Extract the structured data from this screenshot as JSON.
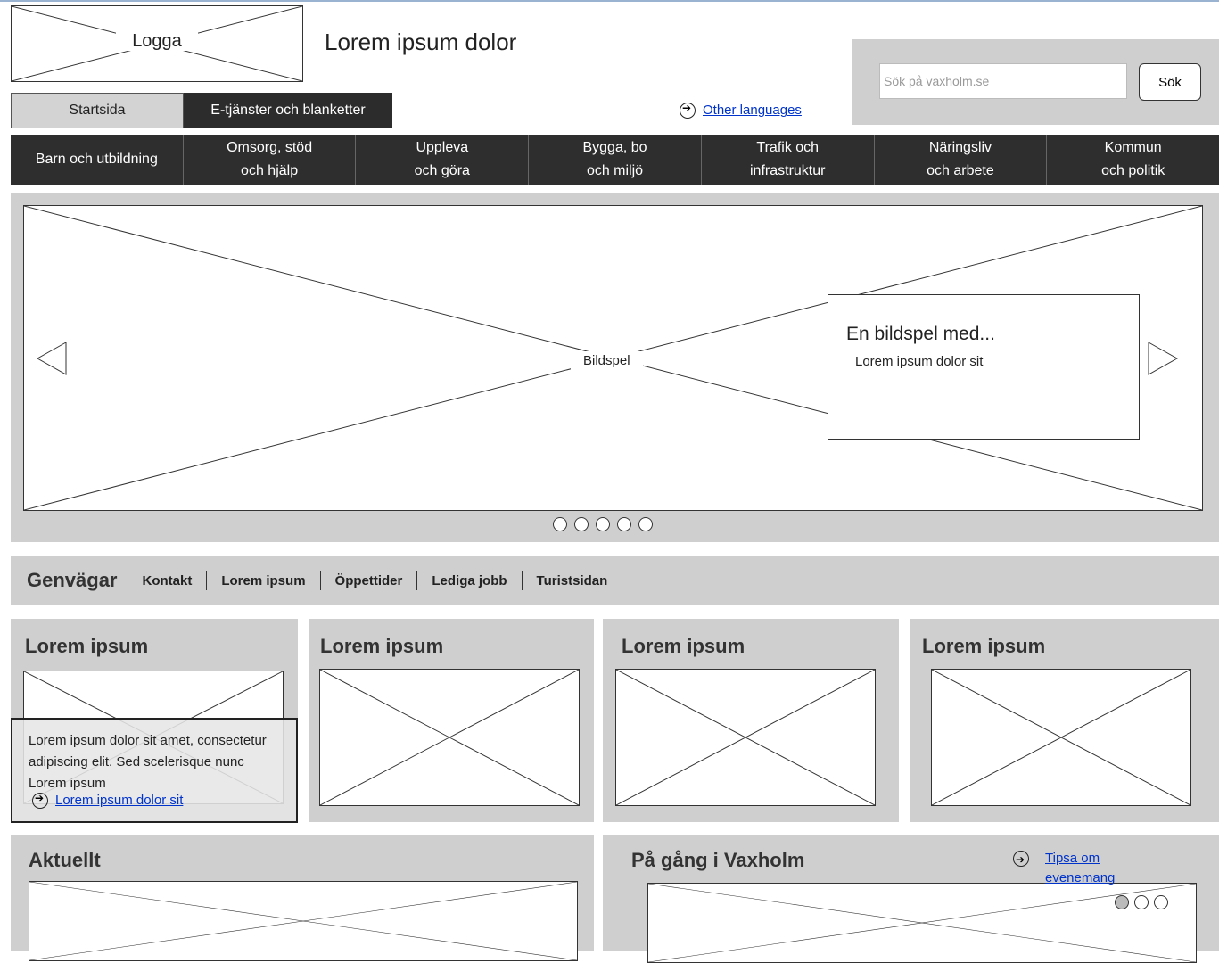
{
  "header": {
    "logo_label": "Logga",
    "site_title": "Lorem ipsum dolor",
    "search": {
      "placeholder": "Sök på vaxholm.se",
      "button_label": "Sök"
    },
    "tabs": [
      {
        "label": "Startsida"
      },
      {
        "label": "E-tjänster och blanketter"
      }
    ],
    "other_languages": "Other languages"
  },
  "nav": {
    "items": [
      {
        "line1": "Barn och utbildning",
        "line2": ""
      },
      {
        "line1": "Omsorg, stöd",
        "line2": "och hjälp"
      },
      {
        "line1": "Uppleva",
        "line2": "och göra"
      },
      {
        "line1": "Bygga, bo",
        "line2": "och miljö"
      },
      {
        "line1": "Trafik och",
        "line2": "infrastruktur"
      },
      {
        "line1": "Näringsliv",
        "line2": "och arbete"
      },
      {
        "line1": "Kommun",
        "line2": "och politik"
      }
    ]
  },
  "slideshow": {
    "label": "Bildspel",
    "caption_title": "En bildspel med...",
    "caption_text": "Lorem ipsum dolor sit",
    "dot_count": 5
  },
  "shortcuts": {
    "title": "Genvägar",
    "links": [
      "Kontakt",
      "Lorem ipsum",
      "Öppettider",
      "Lediga jobb",
      "Turistsidan"
    ]
  },
  "cards": [
    {
      "title": "Lorem ipsum"
    },
    {
      "title": "Lorem ipsum"
    },
    {
      "title": "Lorem ipsum"
    },
    {
      "title": "Lorem ipsum"
    }
  ],
  "card_overlay": {
    "text": "Lorem ipsum dolor sit amet, consectetur adipiscing elit. Sed scelerisque nunc Lorem ipsum",
    "link": "Lorem ipsum dolor sit"
  },
  "news": {
    "title": "Aktuellt"
  },
  "events": {
    "title": "På gång i Vaxholm",
    "tip_link": "Tipsa om evenemang"
  }
}
